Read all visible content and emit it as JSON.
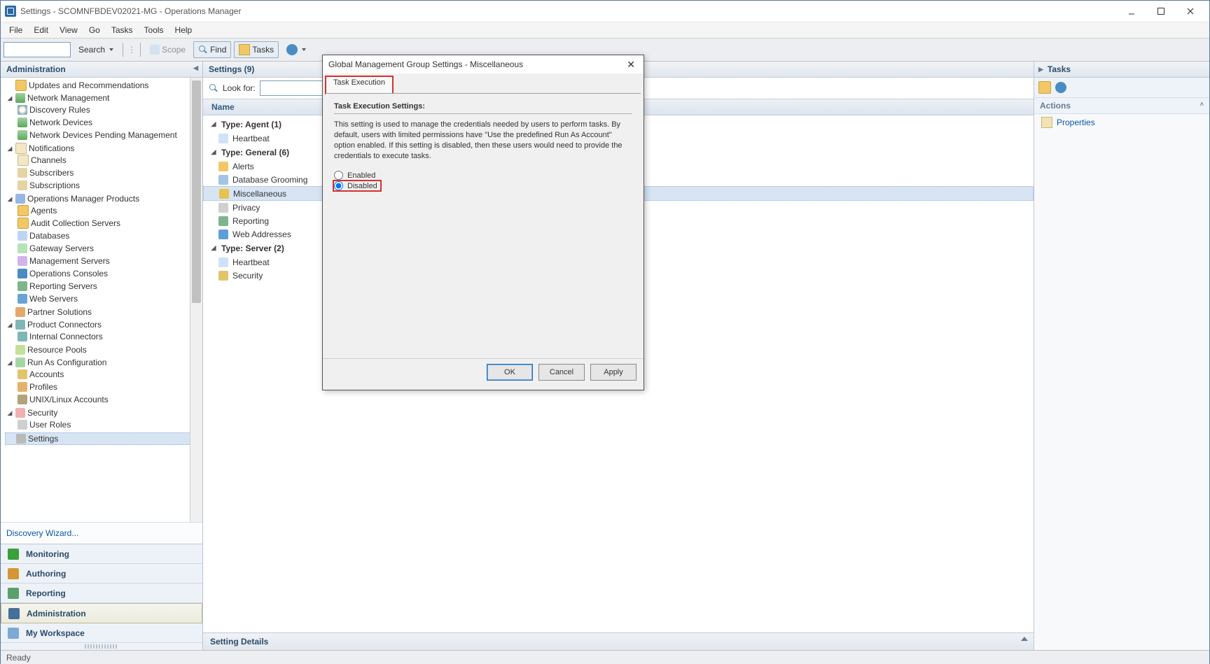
{
  "window": {
    "title": "Settings - SCOMNFBDEV02021-MG - Operations Manager"
  },
  "menu": {
    "file": "File",
    "edit": "Edit",
    "view": "View",
    "go": "Go",
    "tasks": "Tasks",
    "tools": "Tools",
    "help": "Help"
  },
  "toolbar": {
    "search_label": "Search",
    "scope": "Scope",
    "find": "Find",
    "tasks": "Tasks"
  },
  "left": {
    "header": "Administration",
    "tree": {
      "updates": "Updates and Recommendations",
      "network_mgmt": "Network Management",
      "discovery_rules": "Discovery Rules",
      "network_devices": "Network Devices",
      "network_pending": "Network Devices Pending Management",
      "notifications": "Notifications",
      "channels": "Channels",
      "subscribers": "Subscribers",
      "subscriptions": "Subscriptions",
      "om_products": "Operations Manager Products",
      "agents": "Agents",
      "audit": "Audit Collection Servers",
      "databases": "Databases",
      "gateway": "Gateway Servers",
      "mgmt_servers": "Management Servers",
      "consoles": "Operations Consoles",
      "reporting_servers": "Reporting Servers",
      "web_servers": "Web Servers",
      "partner": "Partner Solutions",
      "connectors": "Product Connectors",
      "internal_conn": "Internal Connectors",
      "pools": "Resource Pools",
      "run_as": "Run As Configuration",
      "accounts": "Accounts",
      "profiles": "Profiles",
      "unix": "UNIX/Linux Accounts",
      "security": "Security",
      "user_roles": "User Roles",
      "settings": "Settings"
    },
    "discovery_wizard": "Discovery Wizard...",
    "nav": {
      "monitoring": "Monitoring",
      "authoring": "Authoring",
      "reporting": "Reporting",
      "administration": "Administration",
      "my_workspace": "My Workspace"
    }
  },
  "center": {
    "header": "Settings (9)",
    "lookfor_label": "Look for:",
    "column_name": "Name",
    "groups": {
      "agent": "Type: Agent (1)",
      "general": "Type: General (6)",
      "server": "Type: Server (2)"
    },
    "items": {
      "heartbeat1": "Heartbeat",
      "alerts": "Alerts",
      "db_grooming": "Database Grooming",
      "misc": "Miscellaneous",
      "privacy": "Privacy",
      "reporting": "Reporting",
      "web_addresses": "Web Addresses",
      "heartbeat2": "Heartbeat",
      "security": "Security"
    },
    "details_header": "Setting Details"
  },
  "right": {
    "header": "Tasks",
    "actions_header": "Actions",
    "properties": "Properties"
  },
  "dialog": {
    "title": "Global Management Group Settings - Miscellaneous",
    "tab_task_execution": "Task Execution",
    "section_title": "Task Execution Settings:",
    "description": "This setting is used to manage the credentials needed by users to perform tasks. By default, users with limited permissions have \"Use the predefined Run As Account\" option enabled. If this setting is disabled, then these users would need to provide the credentials to execute tasks.",
    "radio_enabled": "Enabled",
    "radio_disabled": "Disabled",
    "btn_ok": "OK",
    "btn_cancel": "Cancel",
    "btn_apply": "Apply"
  },
  "status": {
    "ready": "Ready"
  }
}
